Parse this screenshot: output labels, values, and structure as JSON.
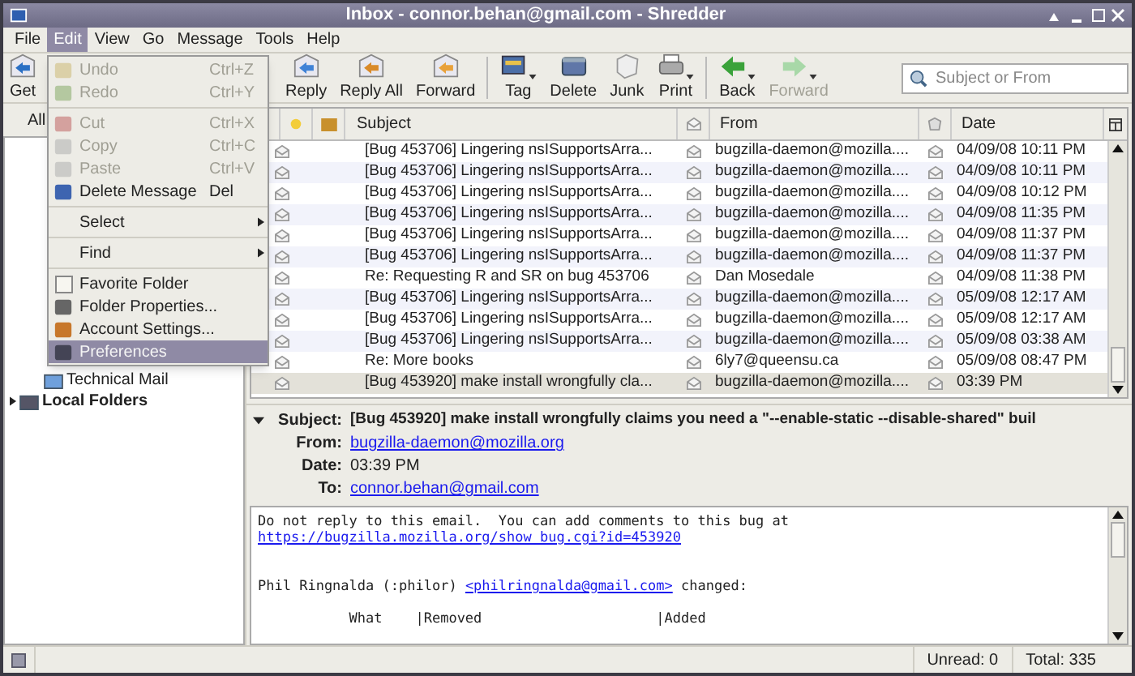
{
  "window": {
    "title": "Inbox - connor.behan@gmail.com - Shredder"
  },
  "menubar": [
    {
      "label": "File",
      "selected": false
    },
    {
      "label": "Edit",
      "selected": true
    },
    {
      "label": "View",
      "selected": false
    },
    {
      "label": "Go",
      "selected": false
    },
    {
      "label": "Message",
      "selected": false
    },
    {
      "label": "Tools",
      "selected": false
    },
    {
      "label": "Help",
      "selected": false
    }
  ],
  "toolbar": [
    {
      "label": "Get",
      "kind": "button",
      "disabled": false
    },
    {
      "label": "Reply",
      "kind": "button",
      "disabled": false
    },
    {
      "label": "Reply All",
      "kind": "button",
      "disabled": false
    },
    {
      "label": "Forward",
      "kind": "button",
      "disabled": false
    },
    {
      "label": "Tag",
      "kind": "dropdown",
      "disabled": false
    },
    {
      "label": "Delete",
      "kind": "button",
      "disabled": false
    },
    {
      "label": "Junk",
      "kind": "button",
      "disabled": false
    },
    {
      "label": "Print",
      "kind": "dropdown",
      "disabled": false
    },
    {
      "label": "Back",
      "kind": "dropdown",
      "disabled": false
    },
    {
      "label": "Forward",
      "kind": "dropdown",
      "disabled": true
    }
  ],
  "search": {
    "placeholder": "Subject or From"
  },
  "folder_pane": {
    "view_label": "All",
    "folders": [
      {
        "name": "Technical Mail",
        "bold": false
      },
      {
        "name": "Local Folders",
        "bold": true
      }
    ]
  },
  "edit_menu": [
    [
      {
        "label": "Undo",
        "shortcut": "Ctrl+Z",
        "kind": "item",
        "disabled": true,
        "selected": false
      },
      {
        "label": "Redo",
        "shortcut": "Ctrl+Y",
        "kind": "item",
        "disabled": true,
        "selected": false
      }
    ],
    [
      {
        "label": "Cut",
        "shortcut": "Ctrl+X",
        "kind": "item",
        "disabled": true,
        "selected": false
      },
      {
        "label": "Copy",
        "shortcut": "Ctrl+C",
        "kind": "item",
        "disabled": true,
        "selected": false
      },
      {
        "label": "Paste",
        "shortcut": "Ctrl+V",
        "kind": "item",
        "disabled": true,
        "selected": false
      },
      {
        "label": "Delete Message",
        "shortcut": "Del",
        "kind": "item",
        "disabled": false,
        "selected": false
      }
    ],
    [
      {
        "label": "Select",
        "kind": "submenu",
        "disabled": false,
        "selected": false
      }
    ],
    [
      {
        "label": "Find",
        "kind": "submenu",
        "disabled": false,
        "selected": false
      }
    ],
    [
      {
        "label": "Favorite Folder",
        "kind": "check",
        "checked": false,
        "disabled": false,
        "selected": false
      },
      {
        "label": "Folder Properties...",
        "kind": "item",
        "disabled": false,
        "selected": false
      },
      {
        "label": "Account Settings...",
        "kind": "item",
        "disabled": false,
        "selected": false
      },
      {
        "label": "Preferences",
        "kind": "item",
        "disabled": false,
        "selected": true
      }
    ]
  ],
  "message_list": {
    "columns": [
      "Subject",
      "From",
      "Date"
    ],
    "rows": [
      {
        "subject": "[Bug 453706] Lingering nsISupportsArra...",
        "from": "bugzilla-daemon@mozilla....",
        "date": "04/09/08 10:11 PM",
        "selected": false
      },
      {
        "subject": "[Bug 453706] Lingering nsISupportsArra...",
        "from": "bugzilla-daemon@mozilla....",
        "date": "04/09/08 10:11 PM",
        "selected": false
      },
      {
        "subject": "[Bug 453706] Lingering nsISupportsArra...",
        "from": "bugzilla-daemon@mozilla....",
        "date": "04/09/08 10:12 PM",
        "selected": false
      },
      {
        "subject": "[Bug 453706] Lingering nsISupportsArra...",
        "from": "bugzilla-daemon@mozilla....",
        "date": "04/09/08 11:35 PM",
        "selected": false
      },
      {
        "subject": "[Bug 453706] Lingering nsISupportsArra...",
        "from": "bugzilla-daemon@mozilla....",
        "date": "04/09/08 11:37 PM",
        "selected": false
      },
      {
        "subject": "[Bug 453706] Lingering nsISupportsArra...",
        "from": "bugzilla-daemon@mozilla....",
        "date": "04/09/08 11:37 PM",
        "selected": false
      },
      {
        "subject": "Re: Requesting R and SR on bug 453706",
        "from": "Dan Mosedale",
        "date": "04/09/08 11:38 PM",
        "selected": false
      },
      {
        "subject": "[Bug 453706] Lingering nsISupportsArra...",
        "from": "bugzilla-daemon@mozilla....",
        "date": "05/09/08 12:17 AM",
        "selected": false
      },
      {
        "subject": "[Bug 453706] Lingering nsISupportsArra...",
        "from": "bugzilla-daemon@mozilla....",
        "date": "05/09/08 12:17 AM",
        "selected": false
      },
      {
        "subject": "[Bug 453706] Lingering nsISupportsArra...",
        "from": "bugzilla-daemon@mozilla....",
        "date": "05/09/08 03:38 AM",
        "selected": false
      },
      {
        "subject": "Re: More books",
        "from": "6ly7@queensu.ca",
        "date": "05/09/08 08:47 PM",
        "selected": false
      },
      {
        "subject": "[Bug 453920] make install wrongfully cla...",
        "from": "bugzilla-daemon@mozilla....",
        "date": "03:39 PM",
        "selected": true
      }
    ]
  },
  "message_header": {
    "expanded": true,
    "fields": [
      {
        "label": "Subject:",
        "value": "[Bug 453920] make install wrongfully claims you need a \"--enable-static --disable-shared\" buil",
        "kind": "bold"
      },
      {
        "label": "From:",
        "value": "bugzilla-daemon@mozilla.org",
        "kind": "link"
      },
      {
        "label": "Date:",
        "value": "03:39 PM",
        "kind": "text"
      },
      {
        "label": "To:",
        "value": "connor.behan@gmail.com",
        "kind": "link"
      }
    ]
  },
  "message_body": [
    {
      "kind": "text",
      "text": "Do not reply to this email.  You can add comments to this bug at"
    },
    {
      "kind": "link",
      "text": "https://bugzilla.mozilla.org/show_bug.cgi?id=453920"
    },
    {
      "kind": "blank"
    },
    {
      "kind": "blank"
    },
    {
      "kind": "mixed",
      "text": "Phil Ringnalda (:philor) ",
      "link": "<philringnalda@gmail.com>",
      "after": " changed:"
    },
    {
      "kind": "blank"
    },
    {
      "kind": "text",
      "text": "           What    |Removed                     |Added"
    }
  ],
  "status_bar": {
    "unread": "Unread: 0",
    "total": "Total: 335"
  }
}
